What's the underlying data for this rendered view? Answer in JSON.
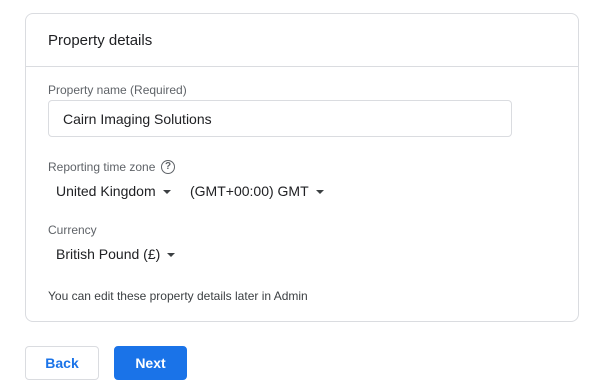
{
  "card": {
    "title": "Property details"
  },
  "property_name": {
    "label": "Property name (Required)",
    "value": "Cairn Imaging Solutions"
  },
  "time_zone": {
    "label": "Reporting time zone",
    "help_icon": "question-circle-icon",
    "country": "United Kingdom",
    "zone": "(GMT+00:00) GMT"
  },
  "currency": {
    "label": "Currency",
    "value": "British Pound (£)"
  },
  "note": "You can edit these property details later in Admin",
  "buttons": {
    "back": "Back",
    "next": "Next"
  },
  "colors": {
    "accent": "#1a73e8",
    "border": "#dadce0"
  }
}
